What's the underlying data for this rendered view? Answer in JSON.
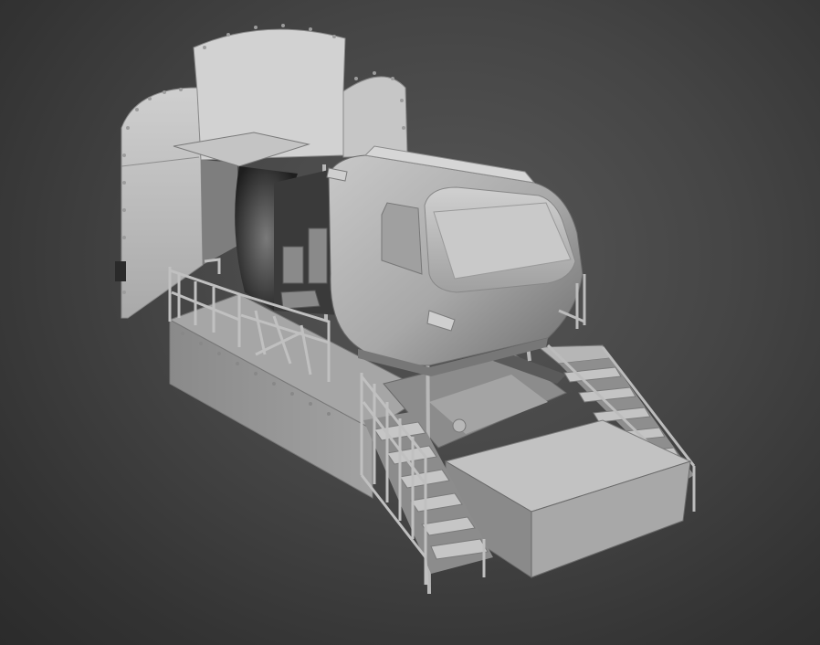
{
  "viewport": {
    "background_top": "#5a5a5a",
    "background_bottom": "#2b2b2b"
  },
  "model": {
    "material_light": "#bdbdbd",
    "material_mid": "#9a9a9a",
    "material_dark": "#6e6e6e",
    "material_shadow": "#444444"
  }
}
